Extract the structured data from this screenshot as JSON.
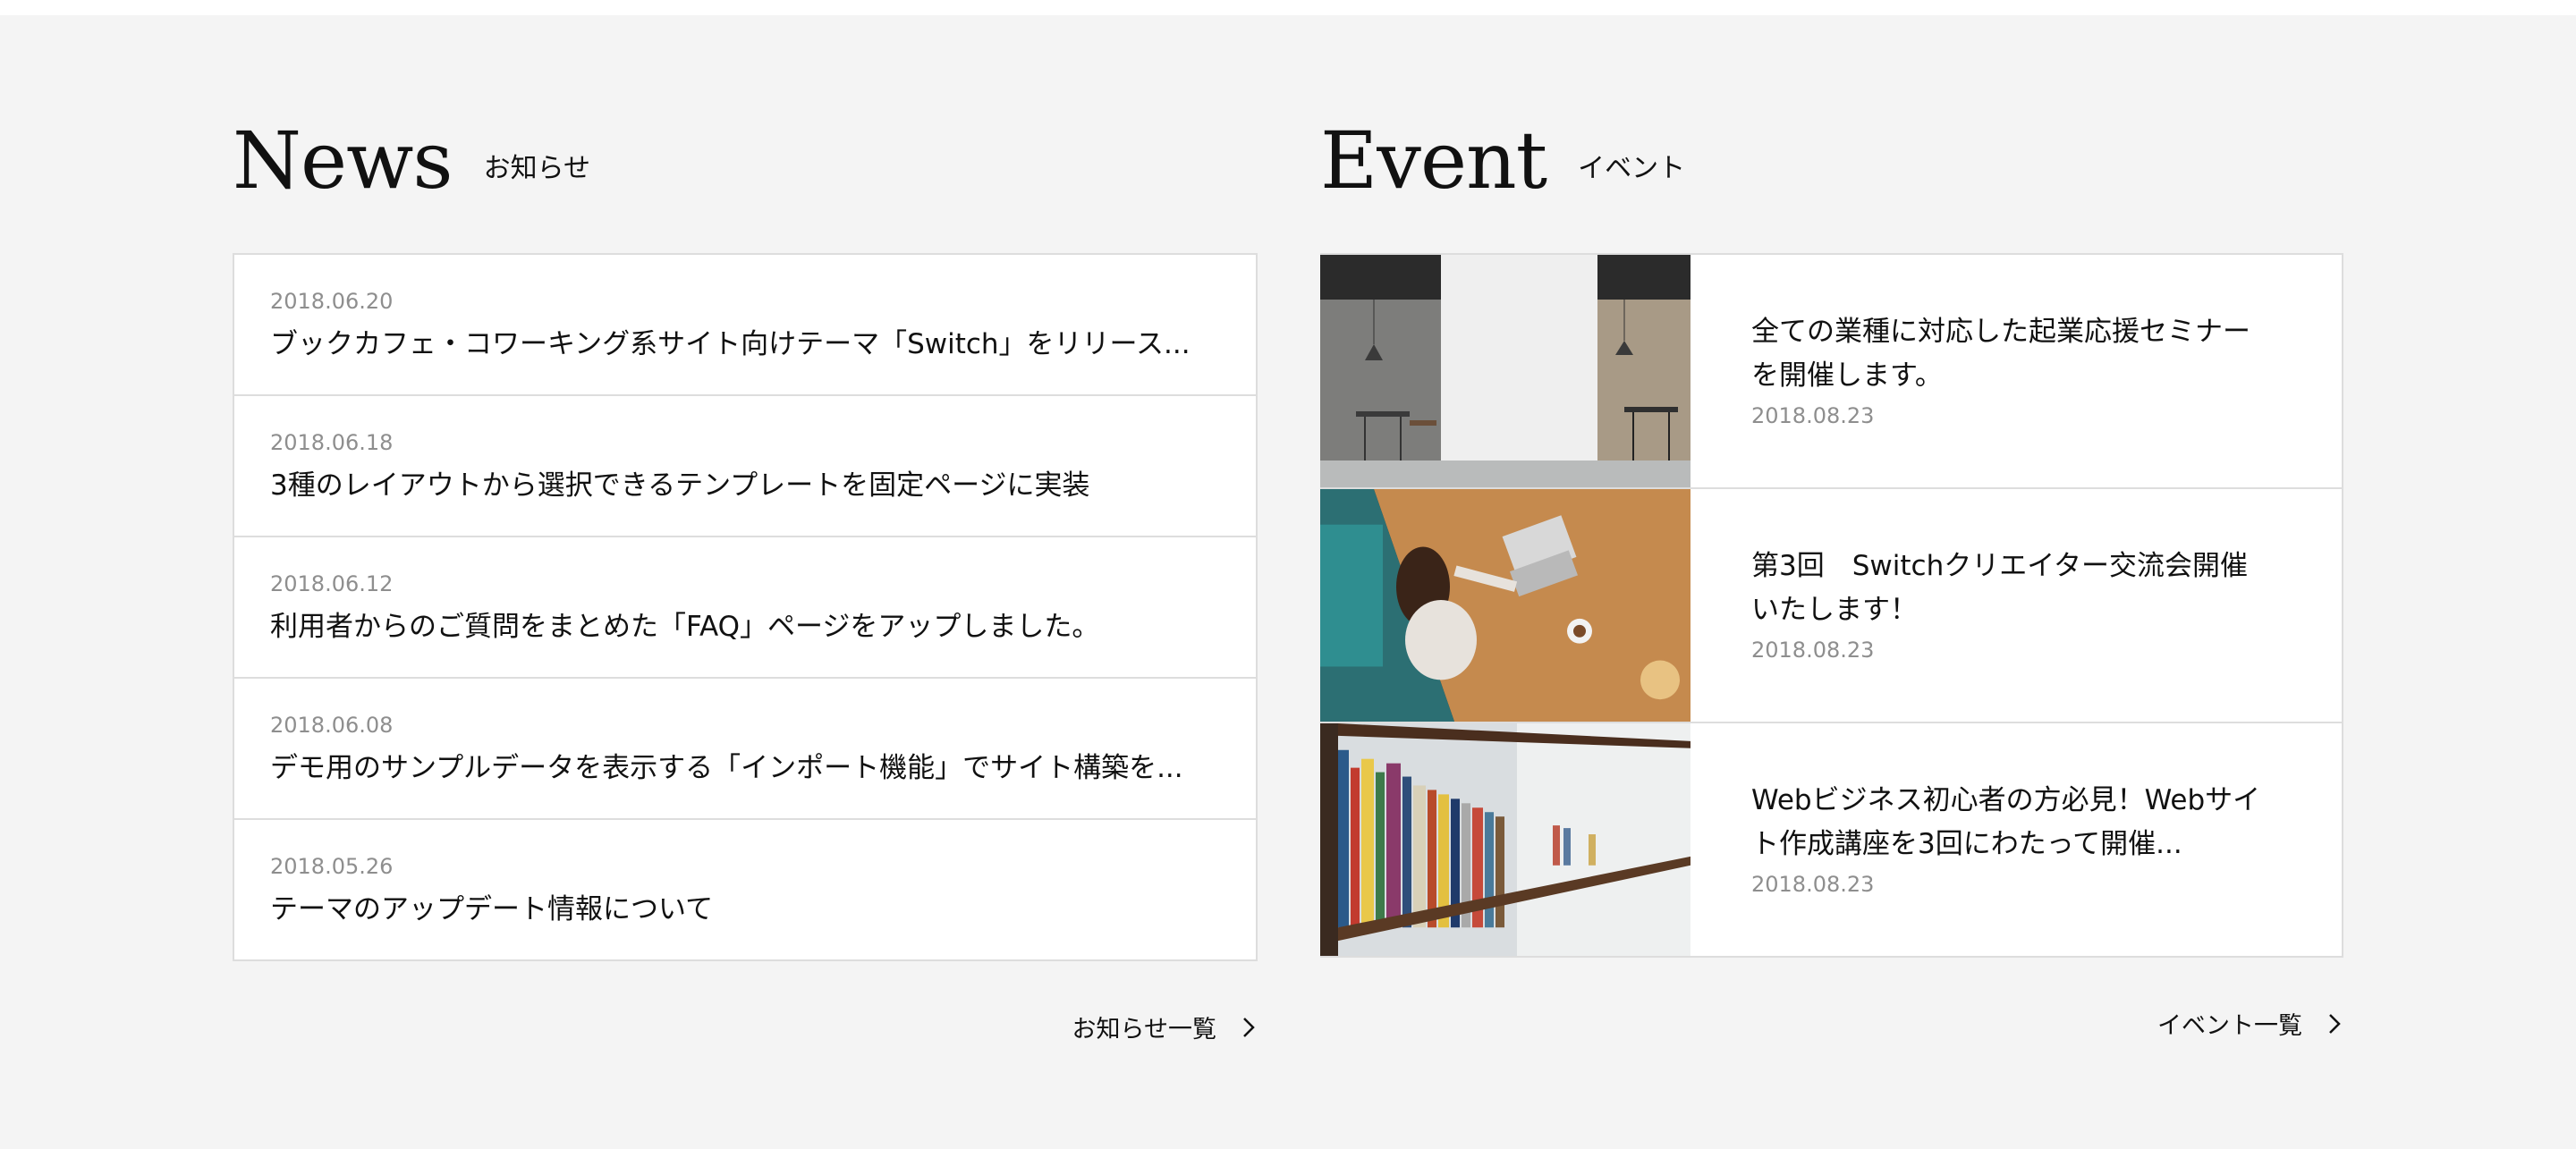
{
  "news": {
    "title_en": "News",
    "title_ja": "お知らせ",
    "items": [
      {
        "date": "2018.06.20",
        "title": "ブックカフェ・コワーキング系サイト向けテーマ「Switch」をリリース..."
      },
      {
        "date": "2018.06.18",
        "title": "3種のレイアウトから選択できるテンプレートを固定ページに実装"
      },
      {
        "date": "2018.06.12",
        "title": "利用者からのご質問をまとめた「FAQ」ページをアップしました。"
      },
      {
        "date": "2018.06.08",
        "title": "デモ用のサンプルデータを表示する「インポート機能」でサイト構築を..."
      },
      {
        "date": "2018.05.26",
        "title": "テーマのアップデート情報について"
      }
    ],
    "more_label": "お知らせ一覧"
  },
  "event": {
    "title_en": "Event",
    "title_ja": "イベント",
    "items": [
      {
        "title_line1": "全ての業種に対応した起業応援セミナー",
        "title_line2": "を開催します。",
        "date": "2018.08.23",
        "image": "cafe-interior-photo"
      },
      {
        "title_line1": "第3回　Switchクリエイター交流会開催",
        "title_line2": "いたします！",
        "date": "2018.08.23",
        "image": "woman-laptop-photo"
      },
      {
        "title_line1": "Webビジネス初心者の方必見！Webサイ",
        "title_line2": "ト作成講座を3回にわたって開催...",
        "date": "2018.08.23",
        "image": "bookshelf-photo"
      }
    ],
    "more_label": "イベント一覧"
  },
  "icons": {
    "more": "chevron-right-icon"
  },
  "colors": {
    "background": "#f4f4f4",
    "border": "#dddddd",
    "date": "#8e8e8e"
  }
}
